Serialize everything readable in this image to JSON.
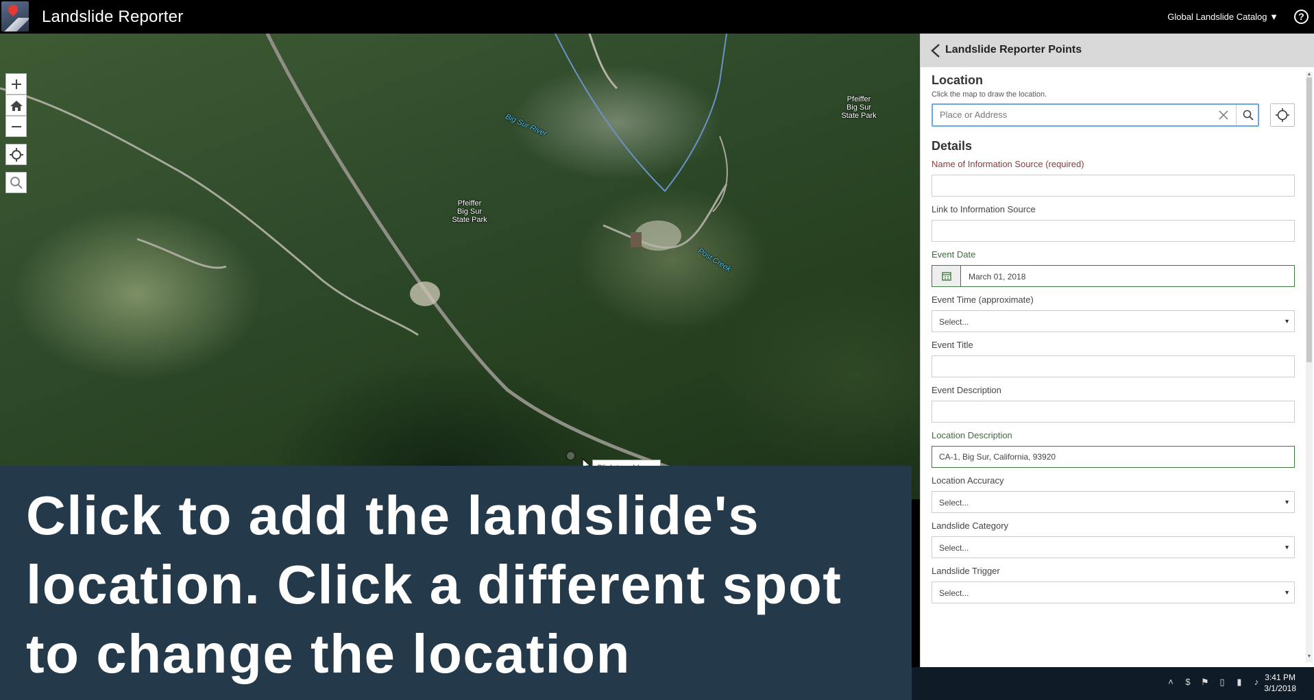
{
  "header": {
    "app_title": "Landslide Reporter",
    "catalog_menu": "Global Landslide Catalog ▼",
    "help_symbol": "?"
  },
  "map": {
    "labels": {
      "park_center": "Pfeiffer\nBig Sur\nState Park",
      "park_right": "Pfeiffer\nBig Sur\nState Park",
      "river_big_sur": "Big Sur River",
      "river_post_creek": "Post Creek"
    },
    "tooltip": "Click to add a point",
    "icons": [
      "zoom-in-icon",
      "home-icon",
      "zoom-out-icon",
      "locate-icon",
      "search-icon"
    ]
  },
  "caption": "Click to add the landslide's location. Click a different spot to change the location",
  "panel": {
    "title": "Landslide Reporter Points",
    "location": {
      "title": "Location",
      "hint": "Click the map to draw the location.",
      "search_placeholder": "Place or Address"
    },
    "details": {
      "title": "Details",
      "fields": {
        "info_source_name": {
          "label": "Name of Information Source (required)",
          "value": ""
        },
        "info_source_link": {
          "label": "Link to Information Source",
          "value": ""
        },
        "event_date": {
          "label": "Event Date",
          "value": "March 01, 2018"
        },
        "event_time": {
          "label": "Event Time (approximate)",
          "value": "Select..."
        },
        "event_title": {
          "label": "Event Title",
          "value": ""
        },
        "event_description": {
          "label": "Event Description",
          "value": ""
        },
        "location_description": {
          "label": "Location Description",
          "value": "CA-1, Big Sur, California, 93920"
        },
        "location_accuracy": {
          "label": "Location Accuracy",
          "value": "Select..."
        },
        "landslide_category": {
          "label": "Landslide Category",
          "value": "Select..."
        },
        "landslide_trigger": {
          "label": "Landslide Trigger",
          "value": "Select..."
        }
      }
    }
  },
  "taskbar": {
    "time": "3:41 PM",
    "date": "3/1/2018"
  },
  "colors": {
    "header_bg": "#000000",
    "caption_bg": "#243a4a",
    "required_label": "#8b3a3a",
    "active_field_border": "#3d7a3d",
    "search_focus": "#6aa7e8",
    "river": "#4fc3f7"
  }
}
